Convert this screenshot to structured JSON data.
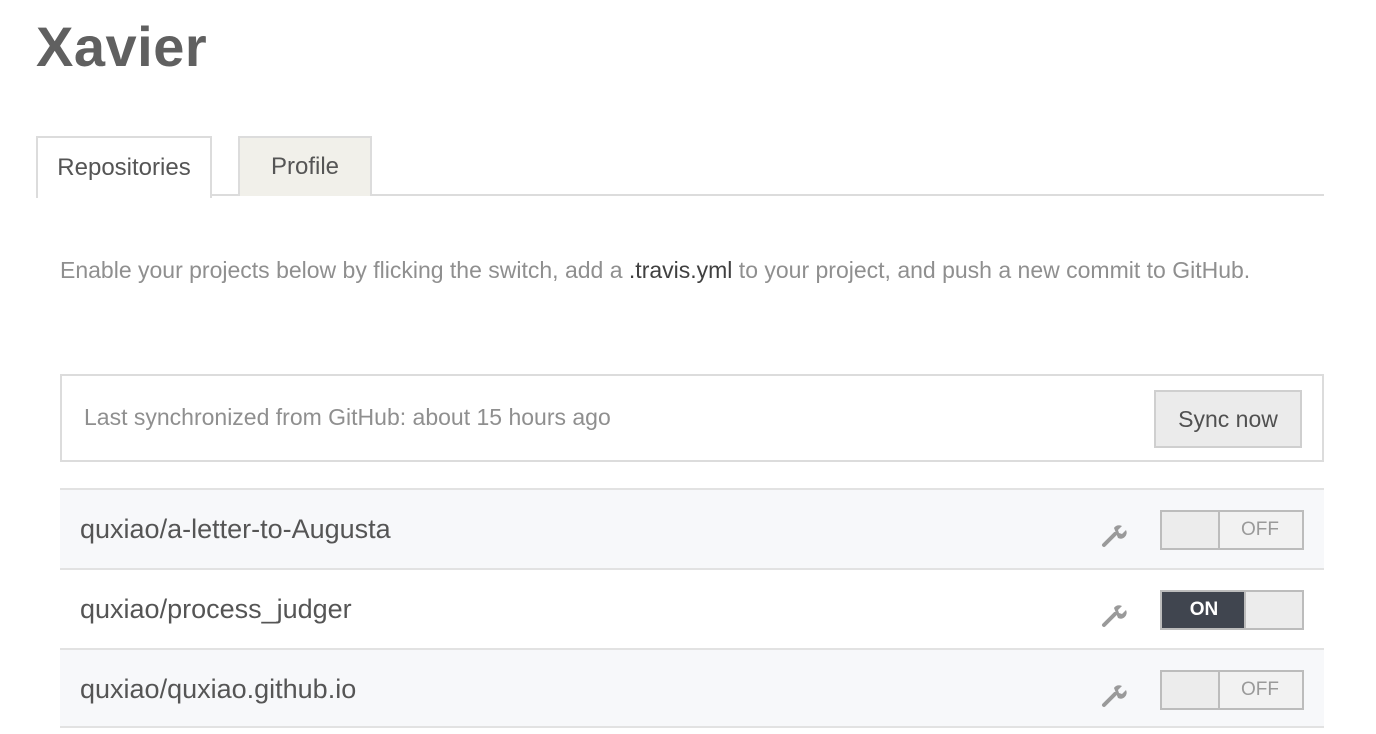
{
  "page": {
    "title": "Xavier"
  },
  "tabs": [
    {
      "label": "Repositories",
      "active": true
    },
    {
      "label": "Profile",
      "active": false
    }
  ],
  "intro": {
    "before": "Enable your projects below by flicking the switch, add a ",
    "code": ".travis.yml",
    "after": " to your project, and push a new commit to GitHub."
  },
  "sync": {
    "status_text": "Last synchronized from GitHub: about 15 hours ago",
    "button_label": "Sync now"
  },
  "repos": [
    {
      "name": "quxiao/a-letter-to-Augusta",
      "toggle_label": "OFF",
      "enabled": false,
      "icon": "wrench-icon"
    },
    {
      "name": "quxiao/process_judger",
      "toggle_label": "ON",
      "enabled": true,
      "icon": "wrench-icon"
    },
    {
      "name": "quxiao/quxiao.github.io",
      "toggle_label": "OFF",
      "enabled": false,
      "icon": "wrench-icon"
    }
  ],
  "colors": {
    "toggle_on_bg": "#40454f",
    "tab_inactive_bg": "#f1f0ea",
    "row_alt_bg": "#f7f8fa"
  }
}
